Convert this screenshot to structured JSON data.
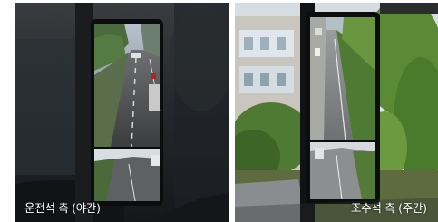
{
  "panels": [
    {
      "caption": "운전석 측 (야간)",
      "scene": "night-driver-side-camera-monitor"
    },
    {
      "caption": "조수석 측 (주간)",
      "scene": "day-passenger-side-camera-monitor"
    }
  ]
}
